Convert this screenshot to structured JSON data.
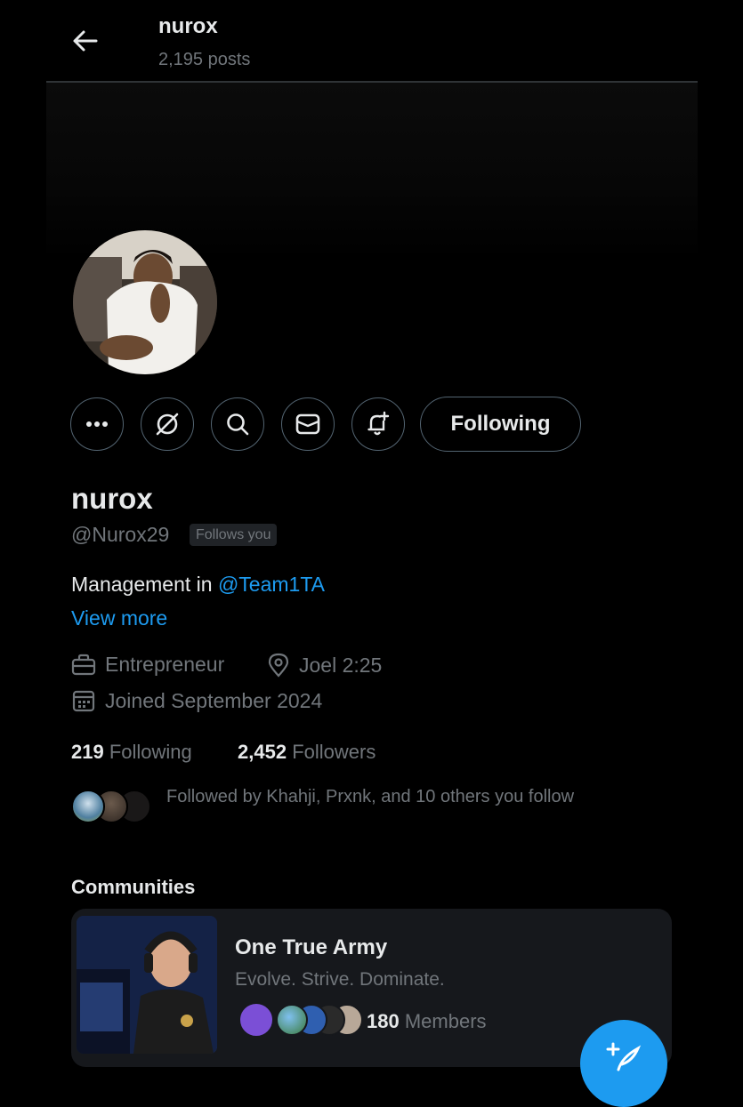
{
  "header": {
    "name": "nurox",
    "posts": "2,195 posts"
  },
  "profile": {
    "display_name": "nurox",
    "handle": "@Nurox29",
    "follows_you": "Follows you",
    "bio_text": "Management in ",
    "bio_mention": "@Team1TA",
    "view_more": "View more",
    "category": "Entrepreneur",
    "location": "Joel 2:25",
    "joined": "Joined September 2024",
    "following_count": "219",
    "following_label": "Following",
    "followers_count": "2,452",
    "followers_label": "Followers",
    "followed_by": "Followed by Khahji, Prxnk, and 10 others you follow"
  },
  "actions": {
    "follow_state": "Following"
  },
  "communities": {
    "title": "Communities",
    "items": [
      {
        "name": "One True Army",
        "tagline": "Evolve. Strive. Dominate.",
        "members_count": "180",
        "members_label": "Members"
      }
    ]
  },
  "colors": {
    "background": "#000000",
    "accent": "#1d9bf0",
    "muted": "#71767b",
    "text": "#e7e9ea",
    "border": "#536471"
  },
  "icons": [
    "back-arrow-icon",
    "more-icon",
    "grok-icon",
    "search-icon",
    "mail-icon",
    "notification-bell-icon",
    "briefcase-icon",
    "location-pin-icon",
    "calendar-icon",
    "compose-icon"
  ]
}
